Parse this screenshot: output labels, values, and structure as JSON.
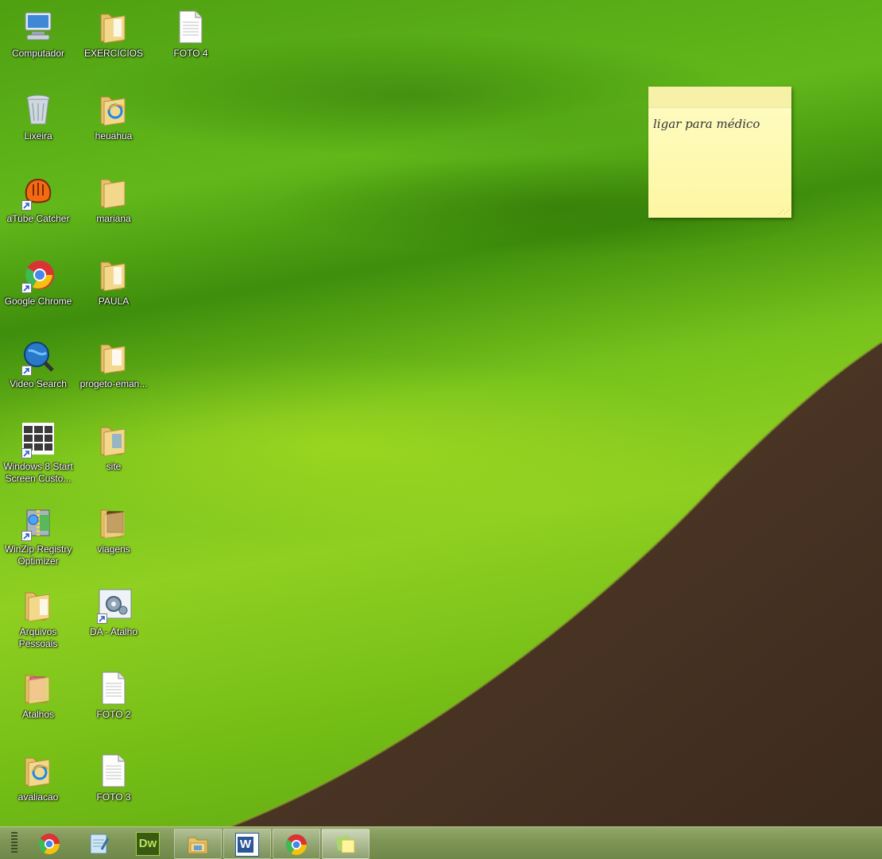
{
  "desktop": {
    "icons": [
      {
        "label": "Computador",
        "icon": "computer-icon"
      },
      {
        "label": "EXERCICIOS",
        "icon": "folder-icon"
      },
      {
        "label": "FOTO 4",
        "icon": "document-icon"
      },
      {
        "label": "Lixeira",
        "icon": "recycle-bin-icon"
      },
      {
        "label": "heuahua",
        "icon": "folder-ie-icon"
      },
      {
        "label": "aTube Catcher",
        "icon": "atube-catcher-icon"
      },
      {
        "label": "mariana",
        "icon": "folder-icon"
      },
      {
        "label": "Google Chrome",
        "icon": "chrome-icon"
      },
      {
        "label": "PAULA",
        "icon": "folder-icon"
      },
      {
        "label": "Video Search",
        "icon": "video-search-icon"
      },
      {
        "label": "progeto-eman...",
        "icon": "folder-icon"
      },
      {
        "label": "Windows 8 Start Screen Custo...",
        "icon": "start-screen-icon"
      },
      {
        "label": "site",
        "icon": "folder-icon"
      },
      {
        "label": "WinZip Registry Optimizer",
        "icon": "winzip-icon"
      },
      {
        "label": "viagens",
        "icon": "folder-photo-icon"
      },
      {
        "label": "Arquivos Pessoais",
        "icon": "folder-icon"
      },
      {
        "label": "DA - Atalho",
        "icon": "settings-shortcut-icon"
      },
      {
        "label": "Atalhos",
        "icon": "folder-pink-icon"
      },
      {
        "label": "FOTO 2",
        "icon": "document-icon"
      },
      {
        "label": "avaliacao",
        "icon": "folder-ie-icon"
      },
      {
        "label": "FOTO 3",
        "icon": "document-icon"
      }
    ]
  },
  "sticky_note": {
    "text": "ligar para médico",
    "bg": "#fdf6a2"
  },
  "taskbar": {
    "pinned": [
      {
        "app": "Google Chrome",
        "icon": "chrome-icon"
      },
      {
        "app": "Notepad",
        "icon": "notepad-icon"
      },
      {
        "app": "Dreamweaver",
        "icon": "dreamweaver-icon",
        "text": "Dw"
      },
      {
        "app": "File Explorer",
        "icon": "explorer-icon"
      },
      {
        "app": "Microsoft Word",
        "icon": "word-icon",
        "text": "W"
      },
      {
        "app": "Google Chrome",
        "icon": "chrome-icon"
      },
      {
        "app": "Sticky Notes",
        "icon": "sticky-notes-icon"
      }
    ]
  }
}
